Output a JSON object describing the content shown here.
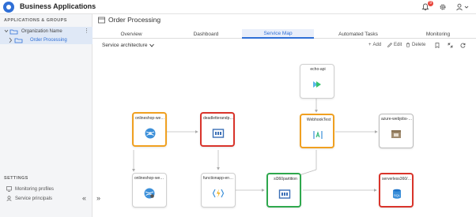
{
  "app": {
    "title": "Business Applications"
  },
  "header": {
    "notification_count": "9"
  },
  "sidebar": {
    "section_title": "APPLICATIONS & GROUPS",
    "org_label": "Organization Name",
    "process_label": "Order Processing",
    "settings_title": "SETTINGS",
    "links": [
      "Monitoring profiles",
      "Service principals"
    ]
  },
  "main": {
    "title": "Order Processing",
    "tabs": [
      "Overview",
      "Dashboard",
      "Service Map",
      "Automated Tasks",
      "Monitoring"
    ],
    "active_tab": "Service Map",
    "view_select": "Service architecture",
    "toolbar": {
      "add": "Add",
      "edit": "Edit",
      "delete": "Delete"
    }
  },
  "service_map": {
    "nodes": [
      {
        "id": "echo",
        "label": "echo-api",
        "status": "gray",
        "icon": "api-management-icon"
      },
      {
        "id": "web1",
        "label": "onlineshop-webapp",
        "status": "orange",
        "icon": "web-app-icon"
      },
      {
        "id": "dead",
        "label": "deadletterandpartition",
        "status": "red",
        "icon": "queue-icon"
      },
      {
        "id": "webhook",
        "label": "WebhookTest",
        "status": "orange",
        "icon": "logic-app-icon"
      },
      {
        "id": "azweb",
        "label": "azure-webjobs-host",
        "status": "lightgray",
        "icon": "storage-icon"
      },
      {
        "id": "web2",
        "label": "onlineshop-webapp",
        "status": "gray",
        "icon": "web-app-icon"
      },
      {
        "id": "func",
        "label": "functionapp-envelope",
        "status": "gray",
        "icon": "function-icon"
      },
      {
        "id": "sl360",
        "label": "sl360partition",
        "status": "green",
        "icon": "queue-icon"
      },
      {
        "id": "sql",
        "label": "serverless360/Batch",
        "status": "red",
        "icon": "sql-database-icon"
      }
    ]
  }
}
